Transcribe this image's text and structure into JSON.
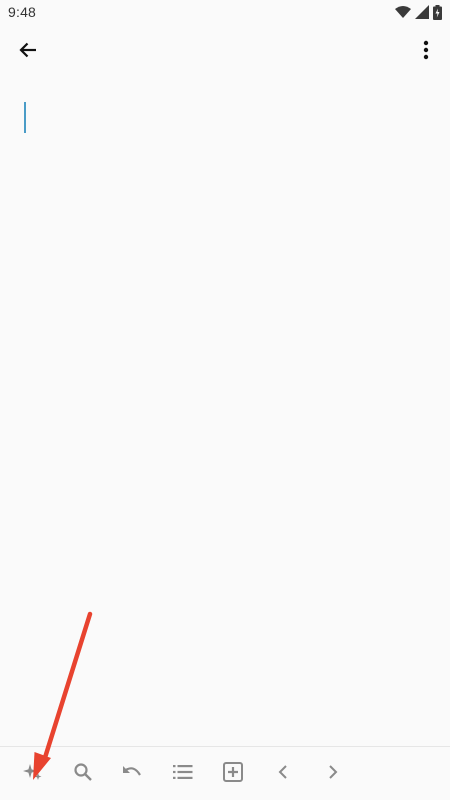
{
  "status_bar": {
    "time": "9:48",
    "icons": [
      "wifi-icon",
      "signal-icon",
      "battery-charging-icon"
    ]
  },
  "app_bar": {
    "back_icon": "arrow-back-icon",
    "menu_icon": "more-vert-icon"
  },
  "editor": {
    "content": ""
  },
  "toolbar": {
    "items": [
      {
        "name": "ai-sparkle-icon"
      },
      {
        "name": "search-icon"
      },
      {
        "name": "undo-icon"
      },
      {
        "name": "list-icon"
      },
      {
        "name": "add-box-icon"
      },
      {
        "name": "chevron-left-icon"
      },
      {
        "name": "chevron-right-icon"
      }
    ]
  },
  "colors": {
    "background": "#fafafa",
    "cursor": "#4a9cc7",
    "toolbar_icon": "#8a8a8a",
    "annotation_arrow": "#e8432f"
  }
}
